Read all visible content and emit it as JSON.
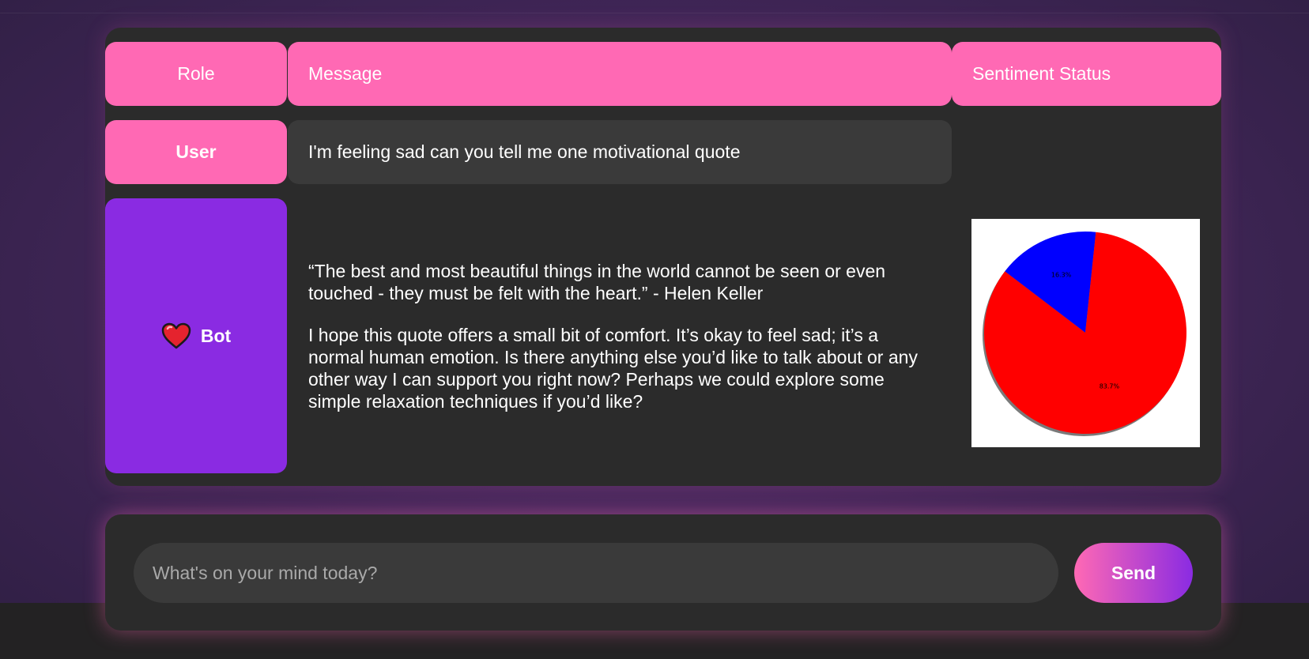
{
  "table": {
    "headers": {
      "role": "Role",
      "message": "Message",
      "sentiment": "Sentiment Status"
    }
  },
  "messages": [
    {
      "role": "User",
      "text": "I'm feeling sad can you tell me one motivational quote"
    },
    {
      "role": "Bot",
      "role_icon": "heart-icon",
      "paragraphs": [
        "“The best and most beautiful things in the world cannot be seen or even touched - they must be felt with the heart.” - Helen Keller",
        "I hope this quote offers a small bit of comfort. It’s okay to feel sad; it’s a normal human emotion. Is there anything else you’d like to talk about or any other way I can support you right now? Perhaps we could explore some simple relaxation techniques if you’d like?"
      ]
    }
  ],
  "sentiment_chart": {
    "type": "pie",
    "slices": [
      {
        "label": "16.3%",
        "value": 16.3,
        "color": "#0000ff"
      },
      {
        "label": "83.7%",
        "value": 83.7,
        "color": "#ff0000"
      }
    ]
  },
  "input": {
    "placeholder": "What's on your mind today?",
    "value": ""
  },
  "send_button": {
    "label": "Send"
  },
  "colors": {
    "accent_pink": "#ff69b4",
    "accent_purple": "#8a2be2",
    "panel": "#2b2b2b",
    "bubble": "#3a3a3a"
  }
}
